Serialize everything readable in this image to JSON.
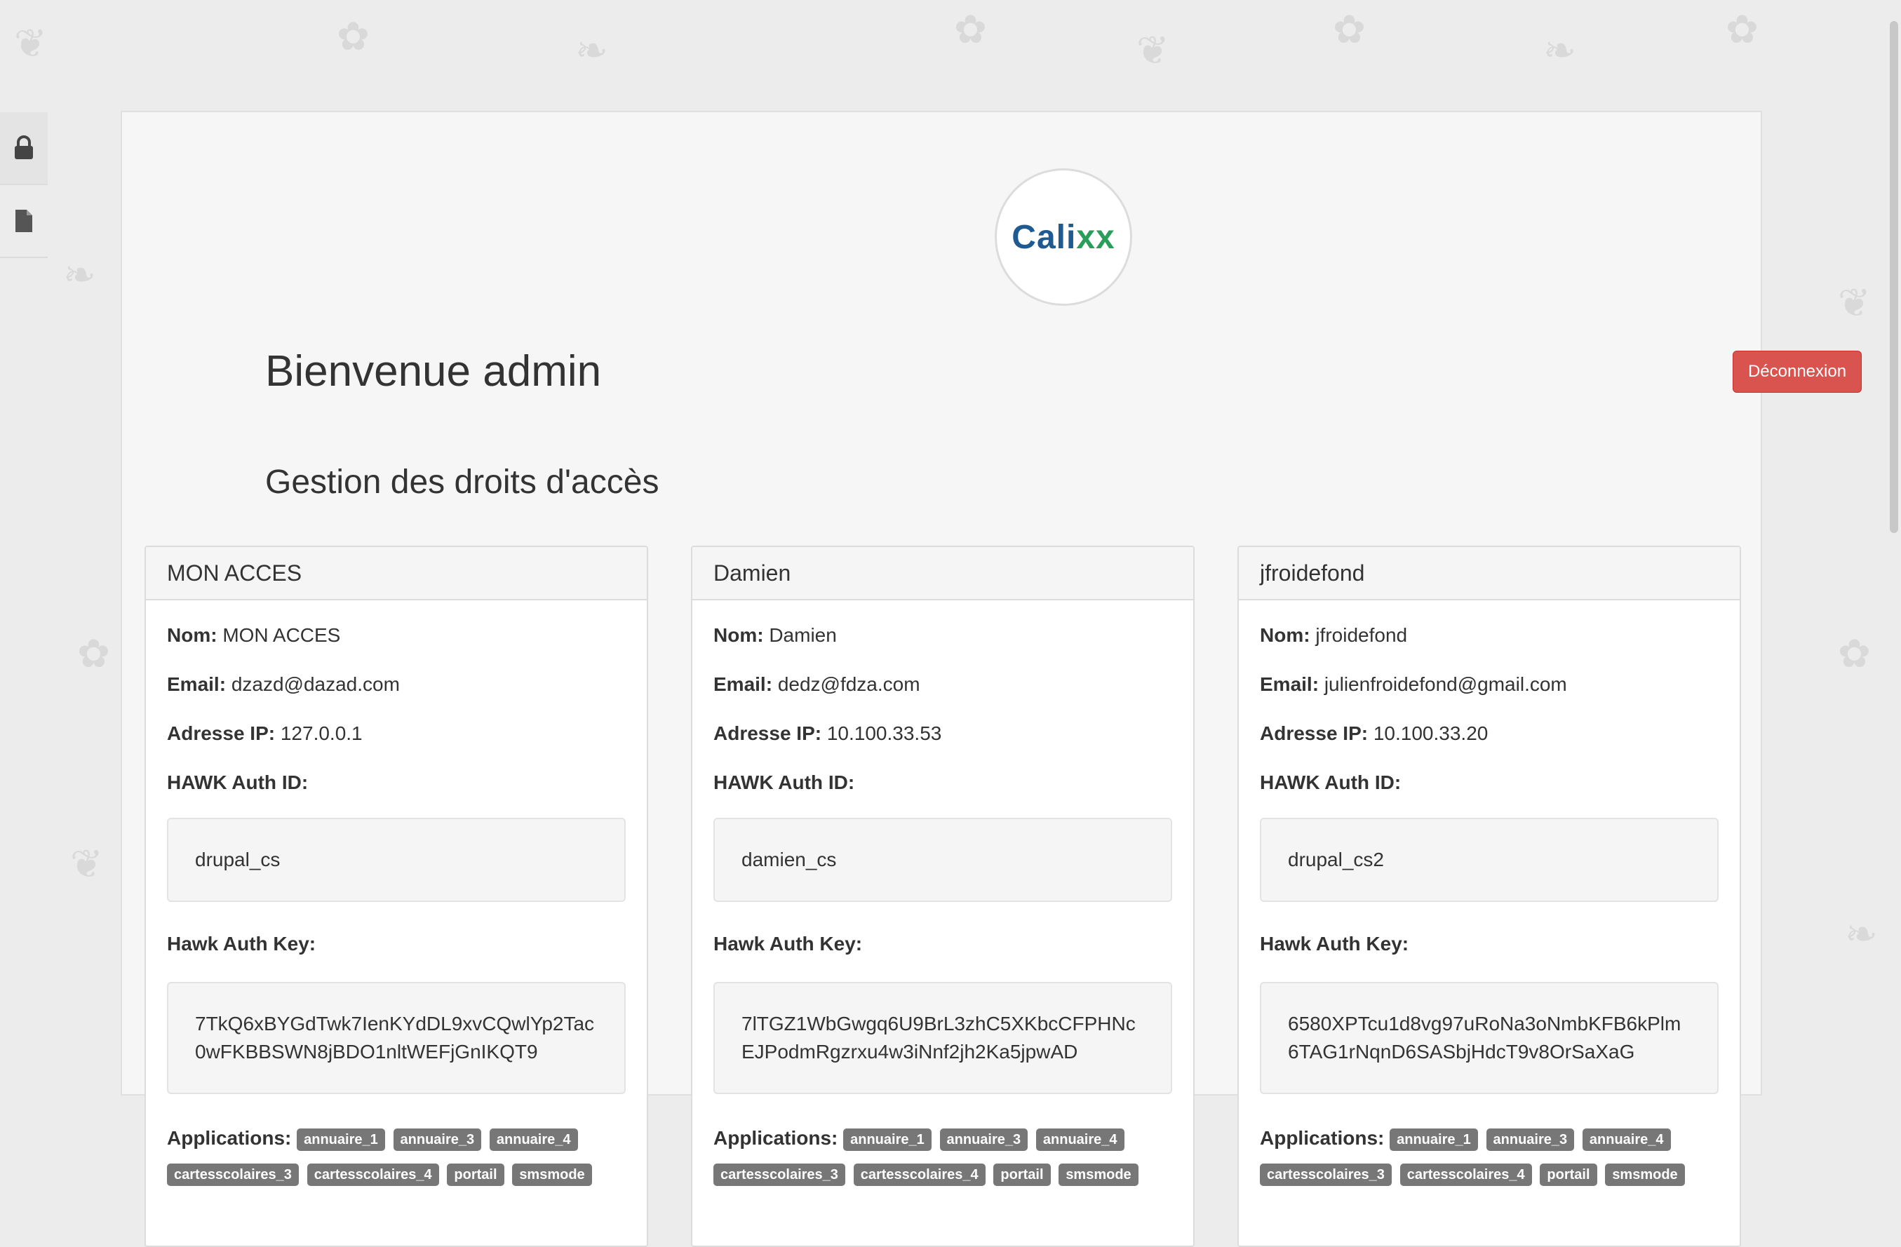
{
  "header": {
    "logo_text_main": "Cali",
    "logo_text_accent": "xx",
    "welcome": "Bienvenue admin",
    "logout_label": "Déconnexion",
    "section_title": "Gestion des droits d'accès"
  },
  "sidebar": {
    "tabs": [
      {
        "icon": "lock-icon"
      },
      {
        "icon": "file-icon"
      }
    ]
  },
  "labels": {
    "name": "Nom:",
    "email": "Email:",
    "ip": "Adresse IP:",
    "hawk_id": "HAWK Auth ID:",
    "hawk_key": "Hawk Auth Key:",
    "apps": "Applications:"
  },
  "cards": [
    {
      "title": "MON ACCES",
      "name": "MON ACCES",
      "email": "dzazd@dazad.com",
      "ip": "127.0.0.1",
      "hawk_id": "drupal_cs",
      "hawk_key": "7TkQ6xBYGdTwk7IenKYdDL9xvCQwlYp2Tac0wFKBBSWN8jBDO1nltWEFjGnIKQT9",
      "apps": [
        "annuaire_1",
        "annuaire_3",
        "annuaire_4",
        "cartesscolaires_3",
        "cartesscolaires_4",
        "portail",
        "smsmode"
      ]
    },
    {
      "title": "Damien",
      "name": "Damien",
      "email": "dedz@fdza.com",
      "ip": "10.100.33.53",
      "hawk_id": "damien_cs",
      "hawk_key": "7lTGZ1WbGwgq6U9BrL3zhC5XKbcCFPHNcEJPodmRgzrxu4w3iNnf2jh2Ka5jpwAD",
      "apps": [
        "annuaire_1",
        "annuaire_3",
        "annuaire_4",
        "cartesscolaires_3",
        "cartesscolaires_4",
        "portail",
        "smsmode"
      ]
    },
    {
      "title": "jfroidefond",
      "name": "jfroidefond",
      "email": "julienfroidefond@gmail.com",
      "ip": "10.100.33.20",
      "hawk_id": "drupal_cs2",
      "hawk_key": "6580XPTcu1d8vg97uRoNa3oNmbKFB6kPlm6TAG1rNqnD6SASbjHdcT9v8OrSaXaG",
      "apps": [
        "annuaire_1",
        "annuaire_3",
        "annuaire_4",
        "cartesscolaires_3",
        "cartesscolaires_4",
        "portail",
        "smsmode"
      ]
    }
  ]
}
